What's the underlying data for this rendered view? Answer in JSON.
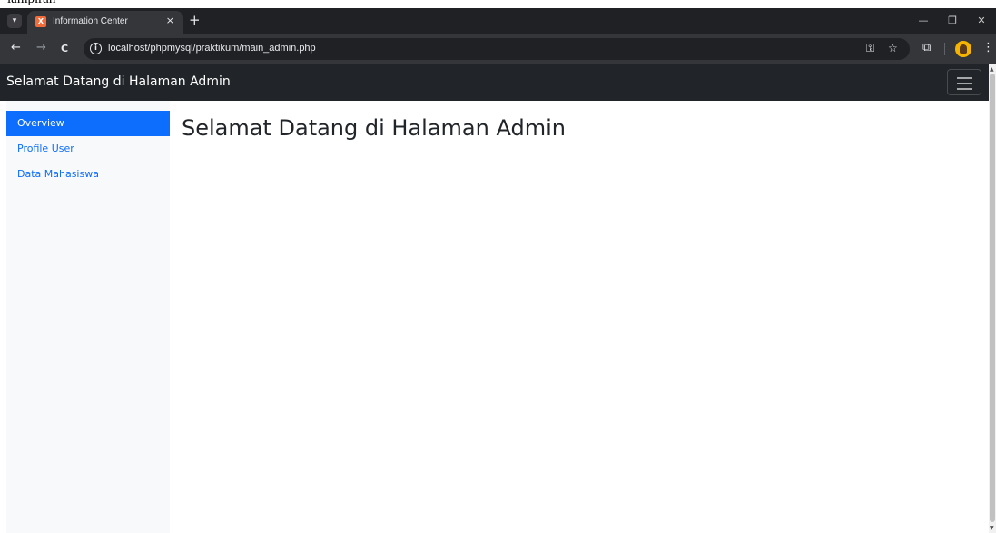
{
  "top_text": "lampiran",
  "browser": {
    "tab": {
      "favicon_text": "X",
      "title": "Information Center",
      "close_glyph": "×"
    },
    "new_tab_glyph": "+",
    "window_controls": {
      "minimize": "—",
      "restore": "❐",
      "close": "✕"
    },
    "toolbar": {
      "back_glyph": "←",
      "forward_glyph": "→",
      "reload_glyph": "C",
      "info_glyph": "i",
      "url": "localhost/phpmysql/praktikum/main_admin.php",
      "key_glyph": "⚿",
      "star_glyph": "☆",
      "extensions_glyph": "⧉",
      "menu_glyph": "⋮"
    }
  },
  "page": {
    "brand": "Selamat Datang di Halaman Admin",
    "sidebar": {
      "items": [
        {
          "label": "Overview",
          "active": true
        },
        {
          "label": "Profile User",
          "active": false
        },
        {
          "label": "Data Mahasiswa",
          "active": false
        }
      ]
    },
    "main_title": "Selamat Datang di Halaman Admin"
  },
  "colors": {
    "navbar": "#212529",
    "sidebar_bg": "#f8f9fa",
    "active": "#0d6efd",
    "link": "#0d6efd"
  },
  "icons": {
    "tab_dropdown": "chevron-down-icon",
    "favicon": "xampp-icon",
    "tab_close": "close-icon",
    "new_tab": "plus-icon",
    "back": "arrow-left-icon",
    "forward": "arrow-right-icon",
    "reload": "reload-icon",
    "info": "info-icon",
    "password": "key-icon",
    "bookmark": "star-icon",
    "extensions": "puzzle-icon",
    "profile": "avatar-icon",
    "menu": "kebab-menu-icon",
    "navbar_toggler": "hamburger-icon"
  }
}
